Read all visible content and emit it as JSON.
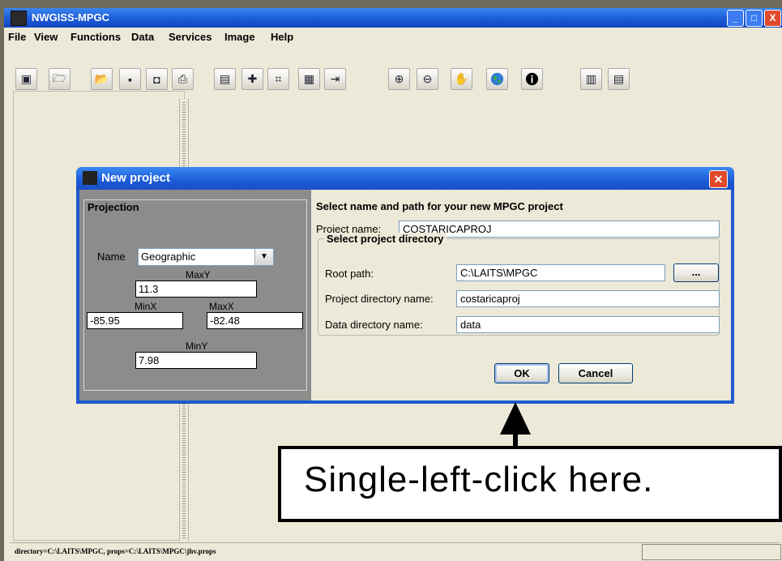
{
  "window": {
    "title": "NWGISS-MPGC"
  },
  "menu": [
    "File",
    "View",
    "Functions",
    "Data",
    "Services",
    "Image",
    "Help"
  ],
  "toolbar": {
    "icons": [
      "layers-icon",
      "open-project-icon",
      "open-folder-icon",
      "save-icon",
      "save-all-icon",
      "print-icon",
      "clipboard-icon",
      "add-layer-icon",
      "grid-icon",
      "tile-icon",
      "export-icon",
      "zoom-in-icon",
      "zoom-out-icon",
      "pan-hand-icon",
      "globe-icon",
      "info-icon",
      "layout-icon",
      "document-icon"
    ]
  },
  "status": {
    "text": "directory=C:\\LAITS\\MPGC, props=C:\\LAITS\\MPGC\\jhv.props"
  },
  "dialog": {
    "title": "New project",
    "close_label": "✕",
    "projection": {
      "legend": "Projection",
      "name_label": "Name",
      "name_value": "Geographic",
      "maxy_label": "MaxY",
      "maxy_value": "11.3",
      "minx_label": "MinX",
      "minx_value": "-85.95",
      "maxx_label": "MaxX",
      "maxx_value": "-82.48",
      "miny_label": "MinY",
      "miny_value": "7.98"
    },
    "form": {
      "heading": "Select name and path for your new MPGC project",
      "project_name_label": "Project name:",
      "project_name_value": "COSTARICAPROJ",
      "dir_legend": "Select project directory",
      "root_path_label": "Root path:",
      "root_path_value": "C:\\LAITS\\MPGC",
      "browse_label": "...",
      "project_dir_label": "Project directory name:",
      "project_dir_value": "costaricaproj",
      "data_dir_label": "Data directory name:",
      "data_dir_value": "data",
      "ok_label": "OK",
      "cancel_label": "Cancel"
    }
  },
  "callout": {
    "text": "Single-left-click here."
  }
}
